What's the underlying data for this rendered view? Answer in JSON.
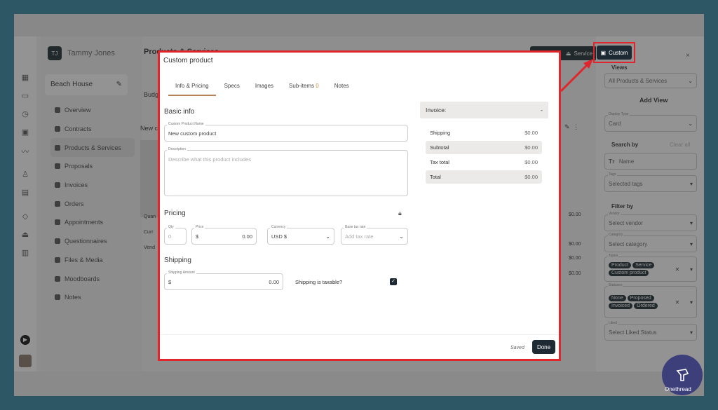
{
  "app": {
    "user": {
      "initials": "TJ",
      "name": "Tammy Jones"
    },
    "project": "Beach House",
    "nav": [
      {
        "label": "Overview"
      },
      {
        "label": "Contracts"
      },
      {
        "label": "Products & Services",
        "active": true
      },
      {
        "label": "Proposals"
      },
      {
        "label": "Invoices"
      },
      {
        "label": "Orders"
      },
      {
        "label": "Appointments"
      },
      {
        "label": "Questionnaires"
      },
      {
        "label": "Files & Media"
      },
      {
        "label": "Moodboards"
      },
      {
        "label": "Notes"
      }
    ],
    "page_title": "Products & Services",
    "background_labels": {
      "budget": "Budg",
      "new": "New c",
      "qty": "Quan",
      "currency": "Curr",
      "vendor": "Vend"
    },
    "background_values": [
      "$0.00",
      "$0.00",
      "$0.00",
      "$0.00"
    ],
    "toolbar": {
      "service": "Service",
      "custom": "Custom"
    },
    "right_panel": {
      "views_label": "Views",
      "views_value": "All Products & Services",
      "add_view": "Add View",
      "display_type_label": "Display Type",
      "display_type_value": "Card",
      "search_by": "Search by",
      "clear_all": "Clear all",
      "name_placeholder": "Name",
      "tags_label": "Tags",
      "tags_placeholder": "Selected tags",
      "filter_by": "Filter by",
      "vendor_label": "Vendor",
      "vendor_placeholder": "Select vendor",
      "category_label": "Category",
      "category_placeholder": "Select category",
      "types_label": "Types",
      "types": [
        "Product",
        "Service",
        "Custom product"
      ],
      "statuses_label": "Statuses",
      "statuses": [
        "None",
        "Proposed",
        "Invoiced",
        "Ordered"
      ],
      "liked_label": "Liked",
      "liked_placeholder": "Select Liked Status"
    }
  },
  "modal": {
    "title": "Custom product",
    "tabs": [
      {
        "label": "Info & Pricing",
        "active": true
      },
      {
        "label": "Specs"
      },
      {
        "label": "Images"
      },
      {
        "label": "Sub-items",
        "count": "0"
      },
      {
        "label": "Notes"
      }
    ],
    "basic_info": "Basic info",
    "name_label": "Custom Product Name",
    "name_value": "New custom product",
    "desc_label": "Description",
    "desc_placeholder": "Describe what this product includes",
    "pricing": "Pricing",
    "qty_label": "Qty",
    "qty_value": "0",
    "price_label": "Price",
    "price_prefix": "$",
    "price_value": "0.00",
    "currency_label": "Currency",
    "currency_value": "USD $",
    "tax_label": "Base tax rate",
    "tax_placeholder": "Add tax rate",
    "shipping": "Shipping",
    "shipping_label": "Shipping Amount",
    "shipping_prefix": "$",
    "shipping_value": "0.00",
    "shipping_taxable": "Shipping is taxable?",
    "shipping_taxable_checked": true,
    "invoice_label": "Invoice:",
    "invoice_value": "-",
    "totals": [
      {
        "label": "Shipping",
        "value": "$0.00"
      },
      {
        "label": "Subtotal",
        "value": "$0.00"
      },
      {
        "label": "Tax total",
        "value": "$0.00"
      },
      {
        "label": "Total",
        "value": "$0.00"
      }
    ],
    "saved": "Saved",
    "done": "Done"
  },
  "brand": {
    "name": "Onethread"
  },
  "colors": {
    "highlight": "#e0262d",
    "dark_button": "#1d2a33",
    "tab_underline": "#b5835a",
    "brand": "#3d3f7a"
  }
}
